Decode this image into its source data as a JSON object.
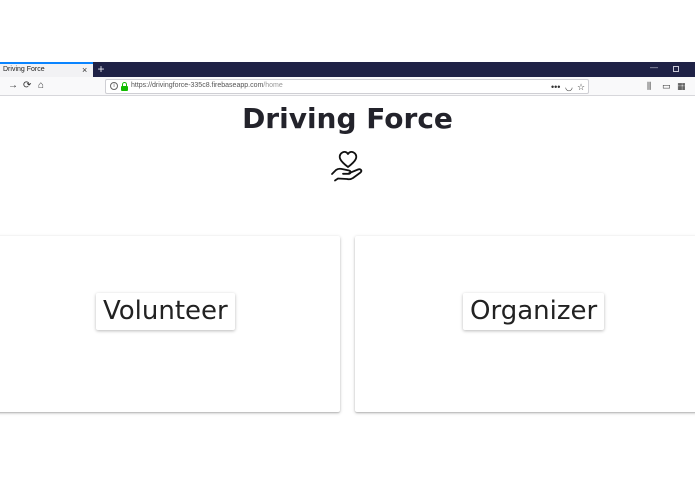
{
  "browser": {
    "tab_title": "Driving Force",
    "tab_close": "×",
    "new_tab": "+",
    "url_host": "https://drivingforce-335c8.firebaseapp.com",
    "url_path": "/home"
  },
  "page": {
    "title": "Driving Force",
    "cards": [
      {
        "label": "Volunteer"
      },
      {
        "label": "Organizer"
      }
    ]
  }
}
